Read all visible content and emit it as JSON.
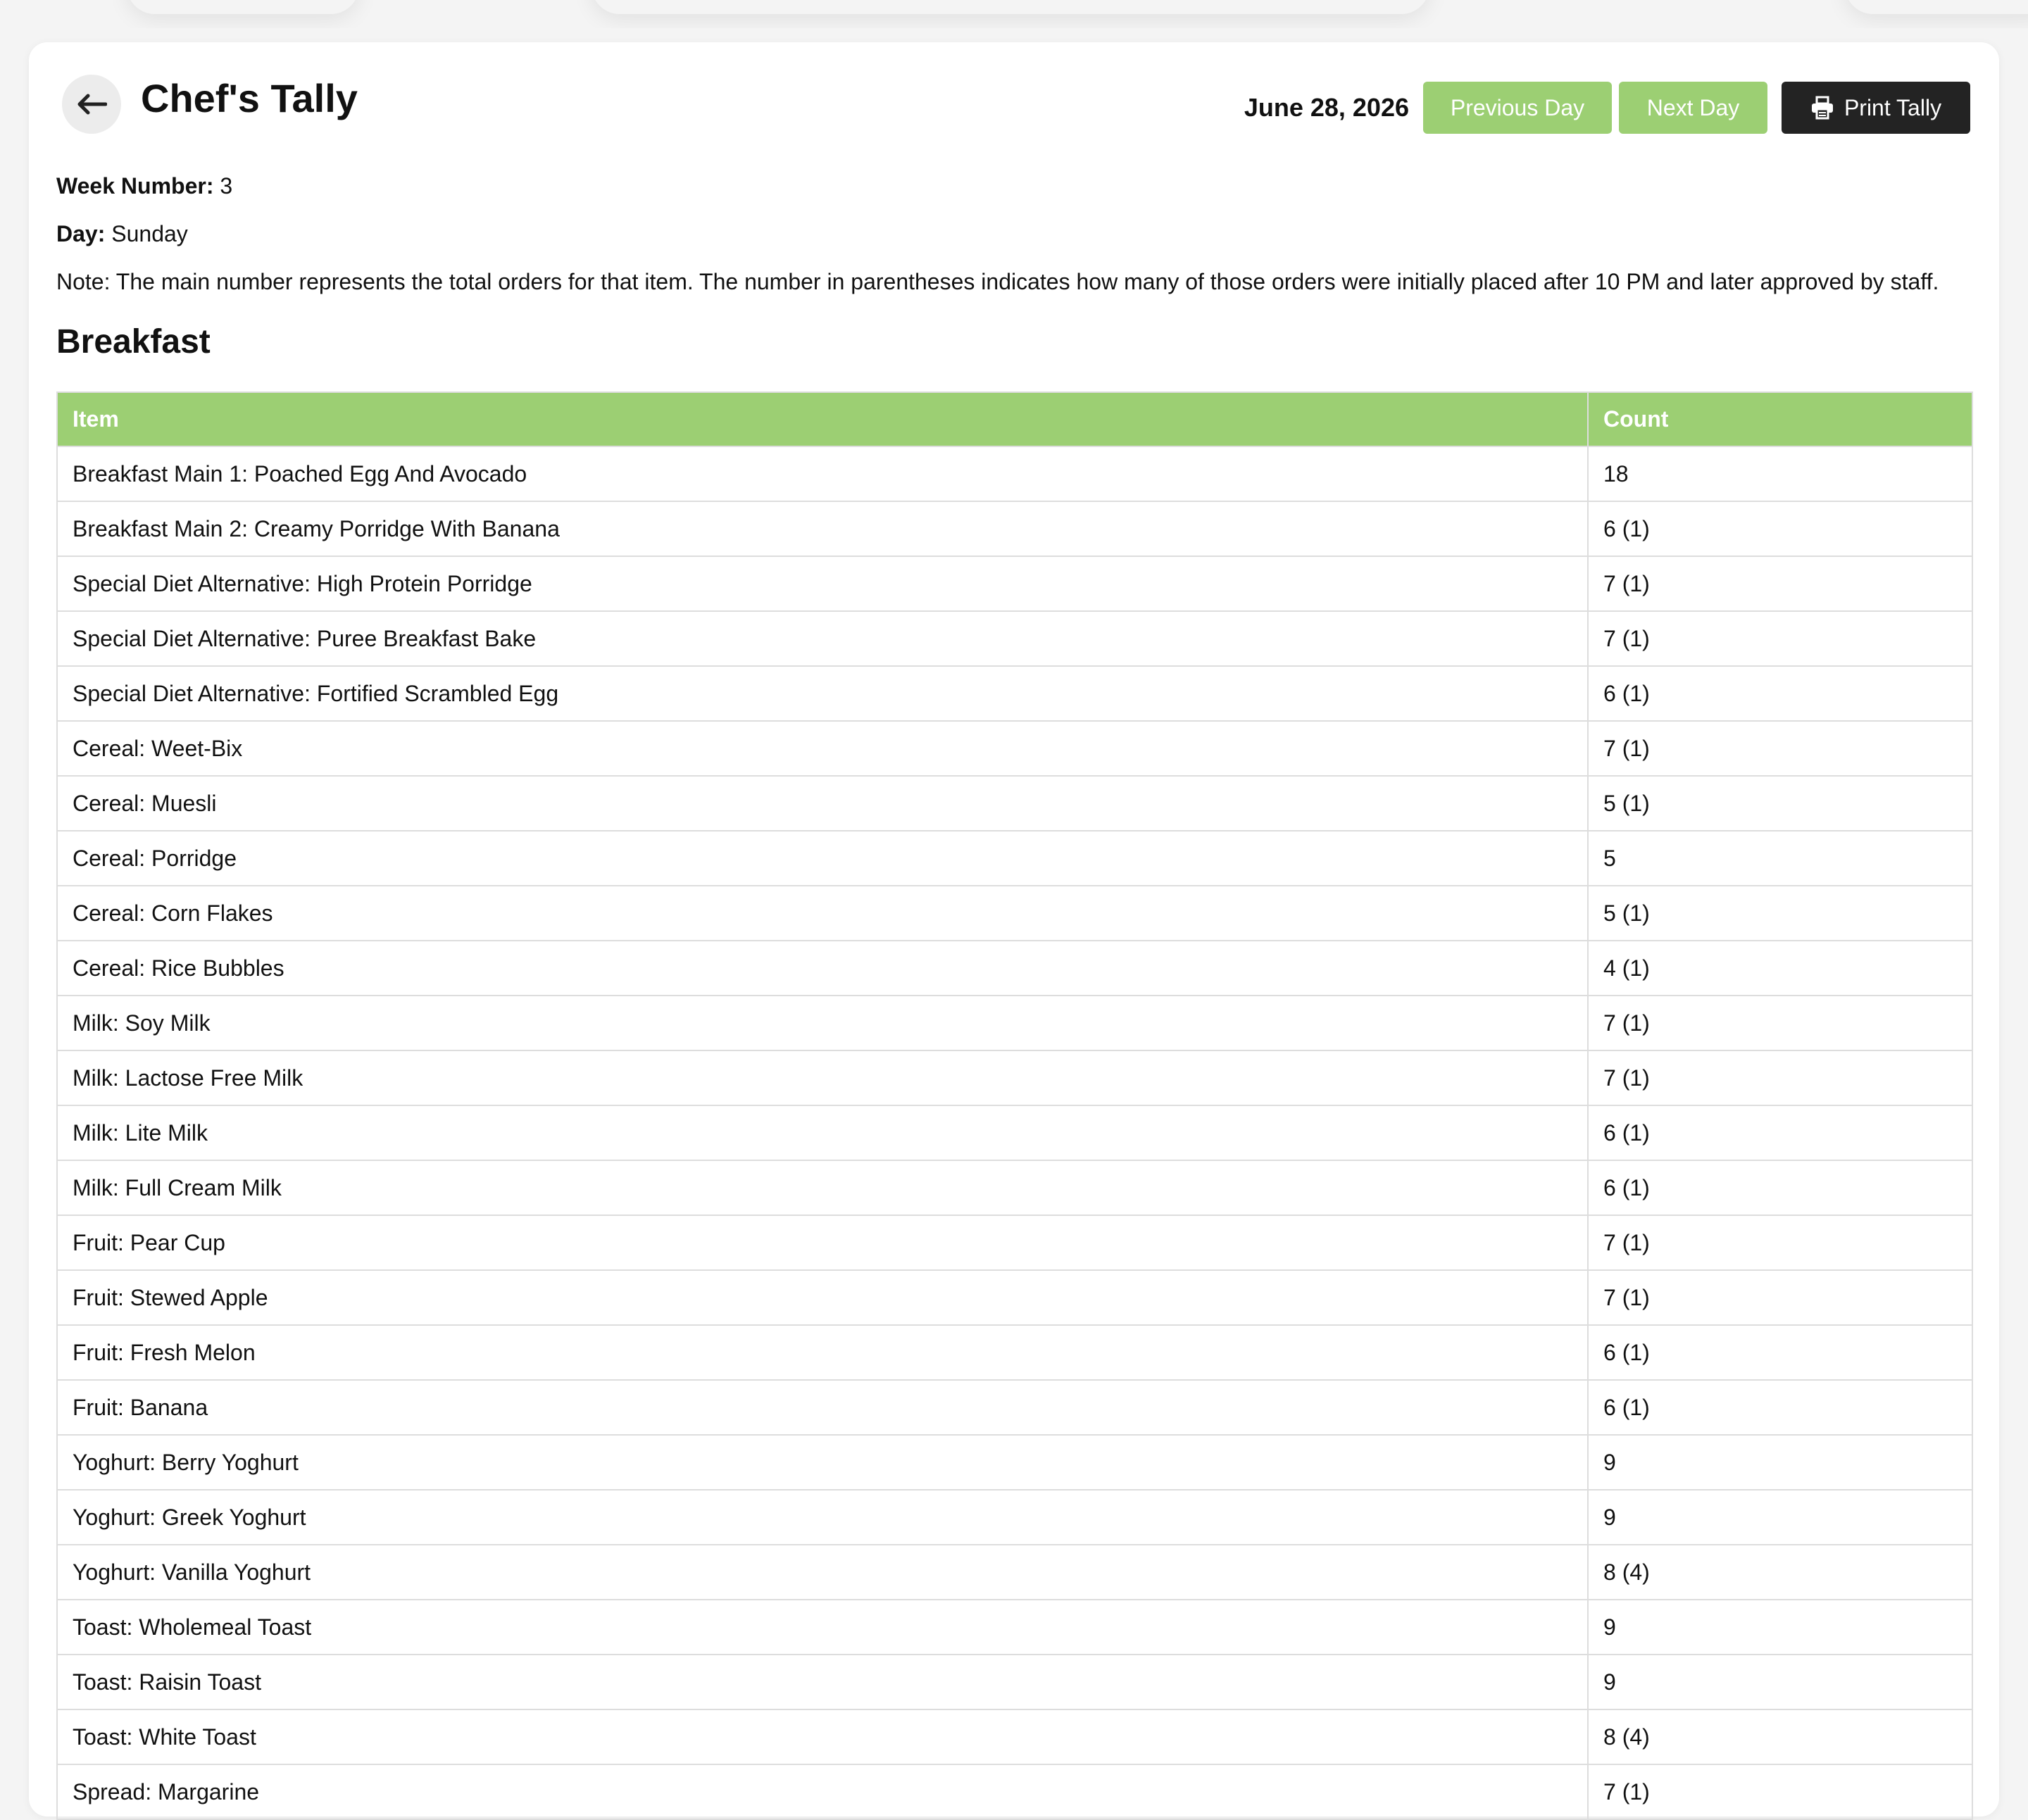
{
  "header": {
    "title": "Chef's Tally",
    "date": "June 28, 2026",
    "previous_label": "Previous Day",
    "next_label": "Next Day",
    "print_label": "Print Tally"
  },
  "meta": {
    "week_label": "Week Number:",
    "week_value": "3",
    "day_label": "Day:",
    "day_value": "Sunday",
    "note": "Note: The main number represents the total orders for that item. The number in parentheses indicates how many of those orders were initially placed after 10 PM and later approved by staff."
  },
  "section": {
    "title": "Breakfast",
    "columns": [
      "Item",
      "Count"
    ],
    "rows": [
      {
        "item": "Breakfast Main 1: Poached Egg And Avocado",
        "count": "18"
      },
      {
        "item": "Breakfast Main 2: Creamy Porridge With Banana",
        "count": "6 (1)"
      },
      {
        "item": "Special Diet Alternative: High Protein Porridge",
        "count": "7 (1)"
      },
      {
        "item": "Special Diet Alternative: Puree Breakfast Bake",
        "count": "7 (1)"
      },
      {
        "item": "Special Diet Alternative: Fortified Scrambled Egg",
        "count": "6 (1)"
      },
      {
        "item": "Cereal: Weet-Bix",
        "count": "7 (1)"
      },
      {
        "item": "Cereal: Muesli",
        "count": "5 (1)"
      },
      {
        "item": "Cereal: Porridge",
        "count": "5"
      },
      {
        "item": "Cereal: Corn Flakes",
        "count": "5 (1)"
      },
      {
        "item": "Cereal: Rice Bubbles",
        "count": "4 (1)"
      },
      {
        "item": "Milk: Soy Milk",
        "count": "7 (1)"
      },
      {
        "item": "Milk: Lactose Free Milk",
        "count": "7 (1)"
      },
      {
        "item": "Milk: Lite Milk",
        "count": "6 (1)"
      },
      {
        "item": "Milk: Full Cream Milk",
        "count": "6 (1)"
      },
      {
        "item": "Fruit: Pear Cup",
        "count": "7 (1)"
      },
      {
        "item": "Fruit: Stewed Apple",
        "count": "7 (1)"
      },
      {
        "item": "Fruit: Fresh Melon",
        "count": "6 (1)"
      },
      {
        "item": "Fruit: Banana",
        "count": "6 (1)"
      },
      {
        "item": "Yoghurt: Berry Yoghurt",
        "count": "9"
      },
      {
        "item": "Yoghurt: Greek Yoghurt",
        "count": "9"
      },
      {
        "item": "Yoghurt: Vanilla Yoghurt",
        "count": "8 (4)"
      },
      {
        "item": "Toast: Wholemeal Toast",
        "count": "9"
      },
      {
        "item": "Toast: Raisin Toast",
        "count": "9"
      },
      {
        "item": "Toast: White Toast",
        "count": "8 (4)"
      },
      {
        "item": "Spread: Margarine",
        "count": "7 (1)"
      }
    ]
  },
  "colors": {
    "accent_green": "#9ccf73",
    "dark_button": "#232323"
  },
  "icons": {
    "back": "arrow-left-icon",
    "print": "printer-icon"
  }
}
